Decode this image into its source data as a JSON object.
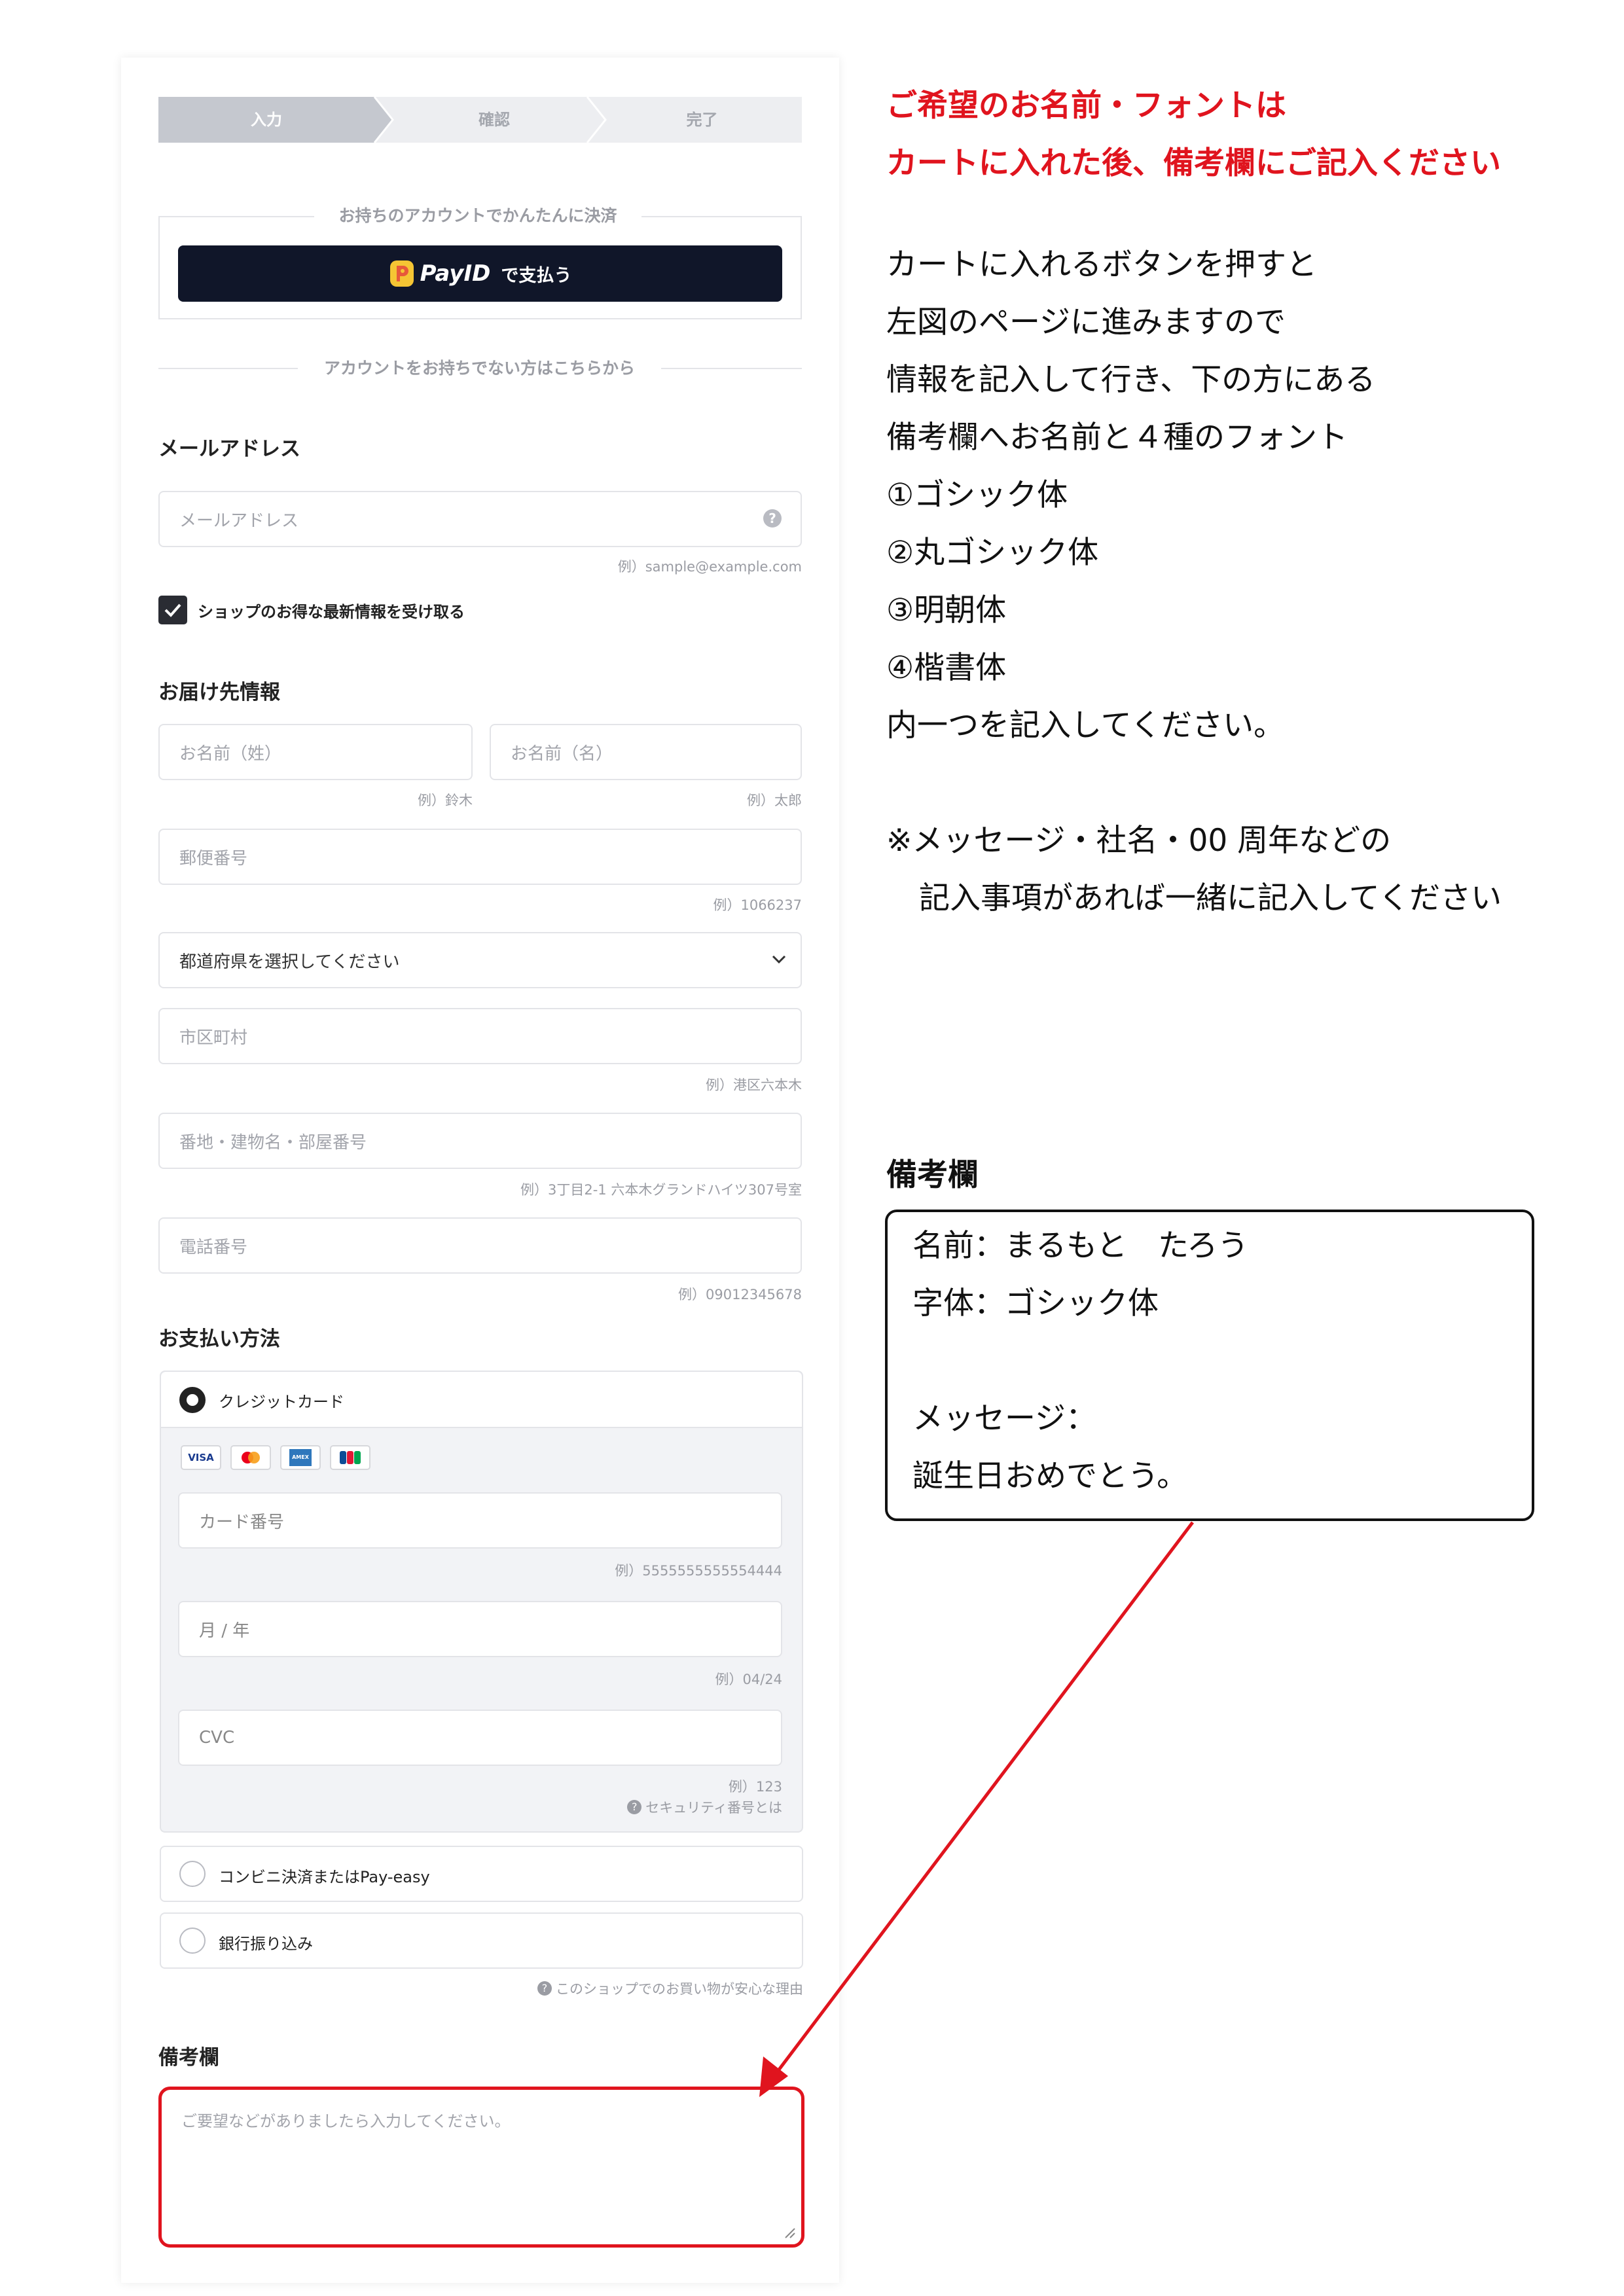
{
  "steps": [
    "入力",
    "確認",
    "完了"
  ],
  "account_section": {
    "title": "お持ちのアカウントでかんたんに決済",
    "payid_brand": "PayID",
    "payid_action": "で支払う"
  },
  "no_account_divider": "アカウントをお持ちでない方はこちらから",
  "email": {
    "label": "メールアドレス",
    "placeholder": "メールアドレス",
    "hint": "例）sample@example.com"
  },
  "newsletter_label": "ショップのお得な最新情報を受け取る",
  "shipping": {
    "label": "お届け先情報",
    "last_name_placeholder": "お名前（姓）",
    "last_name_hint": "例）鈴木",
    "first_name_placeholder": "お名前（名）",
    "first_name_hint": "例）太郎",
    "postal_placeholder": "郵便番号",
    "postal_hint": "例）1066237",
    "prefecture_select": "都道府県を選択してください",
    "city_placeholder": "市区町村",
    "city_hint": "例）港区六本木",
    "address_placeholder": "番地・建物名・部屋番号",
    "address_hint": "例）3丁目2-1 六本木グランドハイツ307号室",
    "phone_placeholder": "電話番号",
    "phone_hint": "例）09012345678"
  },
  "payment": {
    "label": "お支払い方法",
    "credit_card": "クレジットカード",
    "card_logos": [
      "VISA",
      "MC",
      "AMEX",
      "JCB"
    ],
    "card_number_placeholder": "カード番号",
    "card_number_hint": "例）5555555555554444",
    "expiry_placeholder": "月 / 年",
    "expiry_hint": "例）04/24",
    "cvc_placeholder": "CVC",
    "cvc_hint": "例）123",
    "security_hint": "セキュリティ番号とは",
    "convenience": "コンビニ決済またはPay-easy",
    "bank": "銀行振り込み",
    "safety_hint": "このショップでのお買い物が安心な理由"
  },
  "remarks": {
    "label": "備考欄",
    "placeholder": "ご要望などがありましたら入力してください。"
  },
  "instructions": {
    "red_lines": [
      "ご希望のお名前・フォントは",
      "カートに入れた後、備考欄にご記入ください"
    ],
    "lines": [
      "カートに入れるボタンを押すと",
      "左図のページに進みますので",
      "情報を記入して行き、下の方にある",
      "備考欄へお名前と４種のフォント",
      "①ゴシック体",
      "②丸ゴシック体",
      "③明朝体",
      "④楷書体",
      "内一つを記入してください。"
    ],
    "note_lines": [
      "※メッセージ・社名・00 周年などの",
      "記入事項があれば一緒に記入してください"
    ],
    "example_label": "備考欄",
    "example_lines": [
      "名前：まるもと　たろう",
      "字体：ゴシック体",
      "",
      "メッセージ：",
      "誕生日おめでとう。"
    ]
  },
  "colors": {
    "accent_red": "#e0141e",
    "payid_button": "#101629",
    "step_active": "#c5c8cf",
    "step_inactive": "#edeef1"
  }
}
